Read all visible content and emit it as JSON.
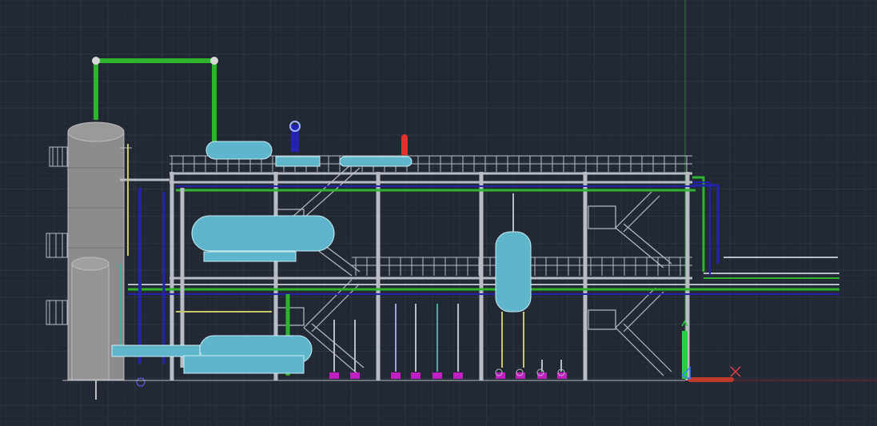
{
  "viewport": {
    "background": "#212733",
    "grid_major_color": "#2f3643",
    "grid_minor_color": "#262c38"
  },
  "ucs_icon": {
    "x_axis_color": "#c0392b",
    "y_axis_color": "#2ecc40",
    "origin_color": "#3b7bff",
    "cross_color": "#e04040"
  },
  "model": {
    "structure_color": "#b8bcc4",
    "vessel_color": "#5fb6cc",
    "vessel_edge_color": "#c9eef5",
    "column_color": "#8c8c8c",
    "pipe_green": "#2db52d",
    "pipe_blue": "#2323b0",
    "pipe_yellow": "#c8c86a",
    "pipe_teal": "#3bb2a6",
    "pump_magenta": "#c21fc2",
    "valve_red": "#e03030"
  }
}
